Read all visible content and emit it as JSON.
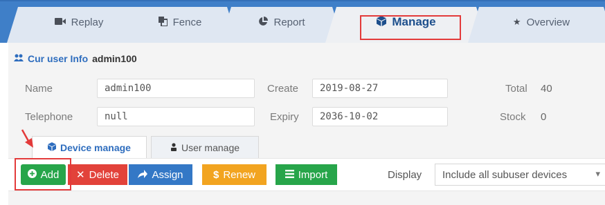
{
  "tabs": [
    {
      "label": "Replay",
      "icon": "video-camera-icon"
    },
    {
      "label": "Fence",
      "icon": "copy-icon"
    },
    {
      "label": "Report",
      "icon": "pie-chart-icon"
    },
    {
      "label": "Manage",
      "icon": "cube-icon",
      "active": true
    },
    {
      "label": "Overview",
      "icon": "star-icon"
    }
  ],
  "user_info": {
    "title": "Cur user Info",
    "username": "admin100",
    "name_label": "Name",
    "name_value": "admin100",
    "telephone_label": "Telephone",
    "telephone_value": "null",
    "create_label": "Create",
    "create_value": "2019-08-27",
    "expiry_label": "Expiry",
    "expiry_value": "2036-10-02",
    "total_label": "Total",
    "total_value": "40",
    "stock_label": "Stock",
    "stock_value": "0"
  },
  "sub_tabs": [
    {
      "label": "Device manage",
      "icon": "cube-icon",
      "active": true
    },
    {
      "label": "User manage",
      "icon": "user-icon"
    }
  ],
  "toolbar": {
    "add_label": "Add",
    "delete_label": "Delete",
    "assign_label": "Assign",
    "renew_label": "Renew",
    "import_label": "Import",
    "display_label": "Display",
    "display_value": "Include all subuser devices"
  },
  "colors": {
    "tab_bar": "#3f7fc8",
    "highlight": "#e33a3a",
    "add": "#27a54a",
    "delete": "#e2423a",
    "assign": "#3478c6",
    "renew": "#f2a420",
    "import": "#27a54a",
    "link_blue": "#2e6dbe"
  }
}
